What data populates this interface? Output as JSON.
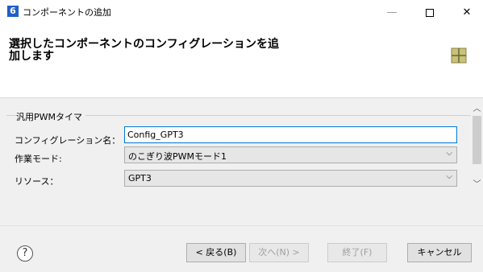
{
  "window": {
    "title": "コンポーネントの追加",
    "app_icon_glyph": "6",
    "minimize_glyph": "—",
    "close_glyph": "✕"
  },
  "header": {
    "title": "選択したコンポーネントのコンフィグレーションを追\n加します"
  },
  "form": {
    "group_label": "汎用PWMタイマ",
    "config_name_label": "コンフィグレーション名：",
    "config_name_value": "Config_GPT3",
    "mode_label": "作業モード:",
    "mode_value": "のこぎり波PWMモード1",
    "resource_label": "リソース：",
    "resource_value": "GPT3"
  },
  "buttons": {
    "back": "< 戻る(B)",
    "next": "次へ(N) >",
    "finish": "終了(F)",
    "cancel": "キャンセル",
    "help": "?"
  },
  "colors": {
    "accent": "#0078d7",
    "app_icon": "#1f5fc7"
  }
}
